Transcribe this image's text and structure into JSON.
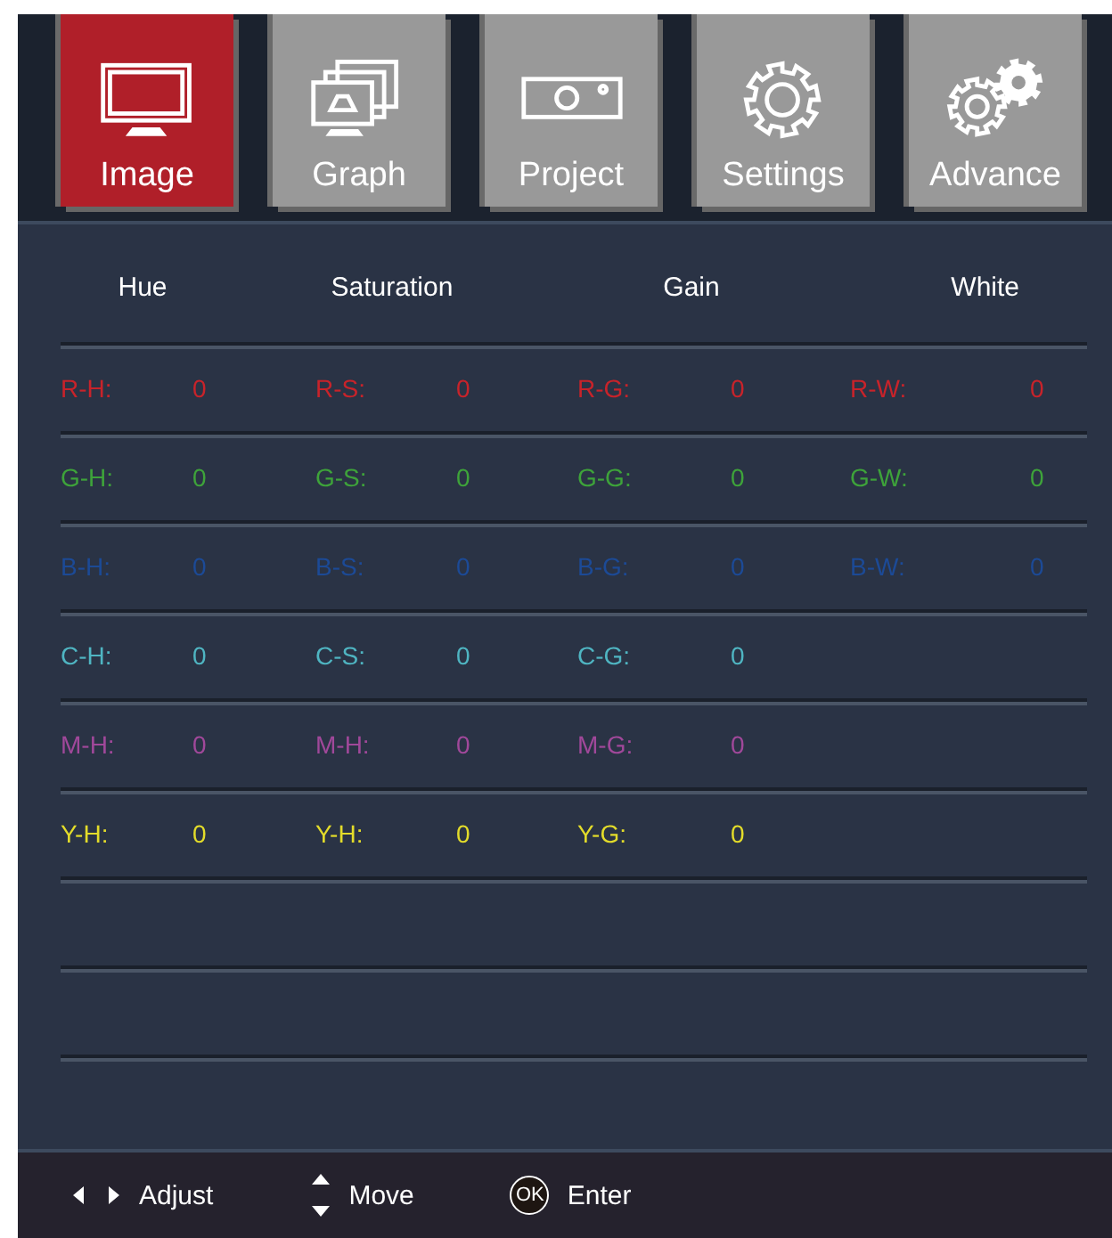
{
  "tabs": [
    {
      "label": "Image",
      "kind": "monitor",
      "selected": true
    },
    {
      "label": "Graph",
      "kind": "screens",
      "selected": false
    },
    {
      "label": "Project",
      "kind": "projector",
      "selected": false
    },
    {
      "label": "Settings",
      "kind": "gear",
      "selected": false
    },
    {
      "label": "Advance",
      "kind": "gears",
      "selected": false
    }
  ],
  "columns": [
    "Hue",
    "Saturation",
    "Gain",
    "White"
  ],
  "rows": [
    {
      "color": "#c8232a",
      "cells": [
        {
          "label": "R-H:",
          "value": "0"
        },
        {
          "label": "R-S:",
          "value": "0"
        },
        {
          "label": "R-G:",
          "value": "0"
        },
        {
          "label": "R-W:",
          "value": "0"
        }
      ]
    },
    {
      "color": "#3ea33a",
      "cells": [
        {
          "label": "G-H:",
          "value": "0"
        },
        {
          "label": "G-S:",
          "value": "0"
        },
        {
          "label": "G-G:",
          "value": "0"
        },
        {
          "label": "G-W:",
          "value": "0"
        }
      ]
    },
    {
      "color": "#1c4a96",
      "cells": [
        {
          "label": "B-H:",
          "value": "0"
        },
        {
          "label": "B-S:",
          "value": "0"
        },
        {
          "label": "B-G:",
          "value": "0"
        },
        {
          "label": "B-W:",
          "value": "0"
        }
      ]
    },
    {
      "color": "#4fb5c2",
      "cells": [
        {
          "label": "C-H:",
          "value": "0"
        },
        {
          "label": "C-S:",
          "value": "0"
        },
        {
          "label": "C-G:",
          "value": "0"
        }
      ]
    },
    {
      "color": "#a0489a",
      "cells": [
        {
          "label": "M-H:",
          "value": "0"
        },
        {
          "label": "M-H:",
          "value": "0"
        },
        {
          "label": "M-G:",
          "value": "0"
        }
      ]
    },
    {
      "color": "#e3dc2a",
      "cells": [
        {
          "label": "Y-H:",
          "value": "0"
        },
        {
          "label": "Y-H:",
          "value": "0"
        },
        {
          "label": "Y-G:",
          "value": "0"
        }
      ]
    }
  ],
  "footer": [
    {
      "kind": "lr",
      "label": "Adjust"
    },
    {
      "kind": "ud",
      "label": "Move"
    },
    {
      "kind": "key",
      "key": "OK",
      "label": "Enter"
    }
  ]
}
